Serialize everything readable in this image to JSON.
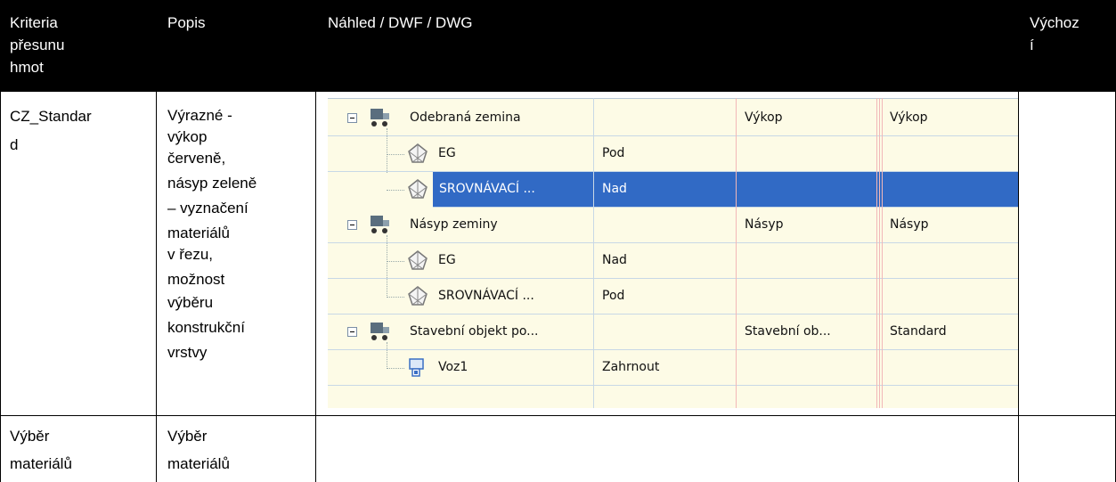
{
  "header": {
    "col1": [
      "Kriteria",
      "přesunu",
      "hmot"
    ],
    "col2": "Popis",
    "col3": "Náhled / DWF / DWG",
    "col4": [
      "Výchoz",
      "í"
    ]
  },
  "rows": [
    {
      "criteria": [
        "CZ_Standar",
        "d"
      ],
      "description": [
        "Výrazné -",
        "výkop",
        "červeně,",
        "násyp zeleně",
        "– vyznačení",
        "materiálů",
        "v řezu,",
        "možnost",
        "výběru",
        "konstrukční",
        "vrstvy"
      ]
    },
    {
      "criteria": [
        "Výběr",
        "materiálů"
      ],
      "description": [
        "Výběr",
        "materiálů"
      ]
    }
  ],
  "preview": {
    "items": [
      {
        "name": "Odebraná zemina",
        "c2": "",
        "c3": "Výkop",
        "c4": "Výkop",
        "type": "group",
        "icon": "truck-icon"
      },
      {
        "name": "EG",
        "c2": "Pod",
        "c3": "",
        "c4": "",
        "type": "surface",
        "icon": "surface-icon"
      },
      {
        "name": "SROVNÁVACÍ ...",
        "c2": "Nad",
        "c3": "",
        "c4": "",
        "type": "surface",
        "icon": "surface-icon",
        "selected": true
      },
      {
        "name": "Násyp zeminy",
        "c2": "",
        "c3": "Násyp",
        "c4": "Násyp",
        "type": "group",
        "icon": "truck-icon"
      },
      {
        "name": "EG",
        "c2": "Nad",
        "c3": "",
        "c4": "",
        "type": "surface",
        "icon": "surface-icon"
      },
      {
        "name": "SROVNÁVACÍ ...",
        "c2": "Pod",
        "c3": "",
        "c4": "",
        "type": "surface",
        "icon": "surface-icon"
      },
      {
        "name": "Stavební objekt po...",
        "c2": "",
        "c3": "Stavební ob...",
        "c4": "Standard",
        "type": "group",
        "icon": "truck-icon"
      },
      {
        "name": "Voz1",
        "c2": "Zahrnout",
        "c3": "",
        "c4": "",
        "type": "corridor",
        "icon": "corridor-icon"
      }
    ]
  },
  "colors": {
    "header_bg": "#000000",
    "selection": "#316ac5",
    "grid_bg": "#fdfbe6",
    "separator": "#f2b8b8"
  }
}
